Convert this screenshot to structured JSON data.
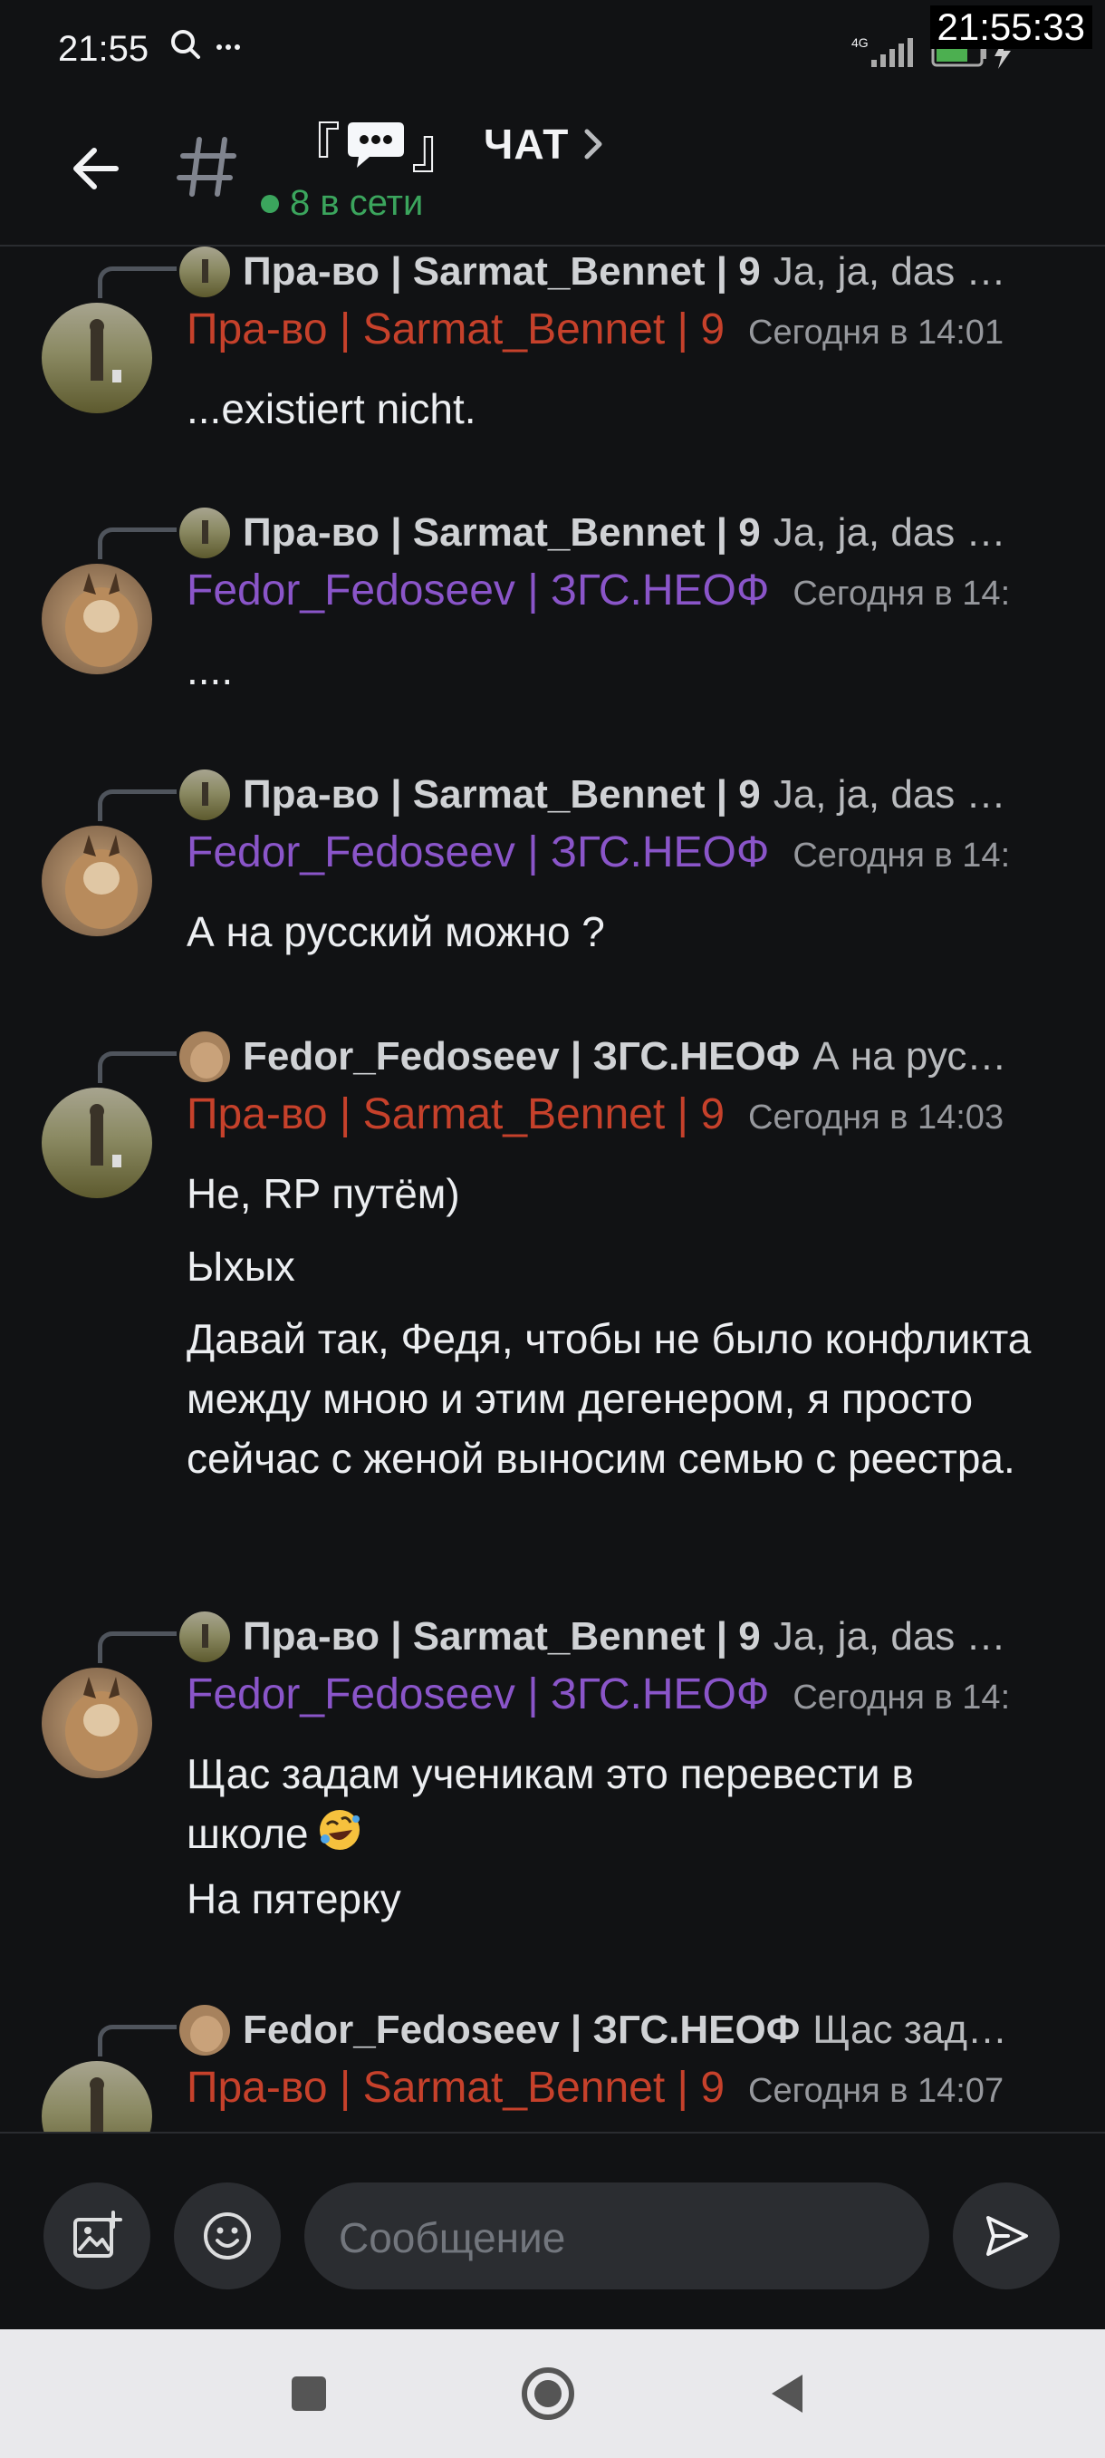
{
  "status_bar": {
    "time": "21:55",
    "clock_overlay": "21:55:33",
    "network": "4G",
    "battery": "69"
  },
  "header": {
    "title_bracket_left": "『",
    "title_bracket_right": "』",
    "title": "ЧАТ",
    "online": "8 в сети"
  },
  "messages": [
    {
      "reply_name": "Пра-во | Sarmat_Bennet | 9",
      "reply_text": "Ja, ja, das …",
      "author": "Пра-во | Sarmat_Bennet | 9",
      "time": "Сегодня в 14:01",
      "lines": [
        "...existiert nicht."
      ]
    },
    {
      "reply_name": "Пра-во | Sarmat_Bennet | 9",
      "reply_text": "Ja, ja, das …",
      "author": "Fedor_Fedoseev | ЗГС.НЕОФ",
      "time": "Сегодня в 14:",
      "lines": [
        "...."
      ]
    },
    {
      "reply_name": "Пра-во | Sarmat_Bennet | 9",
      "reply_text": "Ja, ja, das …",
      "author": "Fedor_Fedoseev | ЗГС.НЕОФ",
      "time": "Сегодня в 14:",
      "lines": [
        "А на русский можно ?"
      ]
    },
    {
      "reply_name": "Fedor_Fedoseev | ЗГС.НЕОФ",
      "reply_text": "А на рус…",
      "author": "Пра-во | Sarmat_Bennet | 9",
      "time": "Сегодня в 14:03",
      "lines": [
        "Не, RP путём)",
        "Ыхых",
        "Давай так, Федя, чтобы не было конфликта между мною и этим дегенером, я просто сейчас с женой выносим семью с реестра."
      ]
    },
    {
      "reply_name": "Пра-во | Sarmat_Bennet | 9",
      "reply_text": "Ja, ja, das …",
      "author": "Fedor_Fedoseev | ЗГС.НЕОФ",
      "time": "Сегодня в 14:",
      "lines": [
        "Щас задам ученикам это перевести в школе",
        "На пятерку"
      ]
    },
    {
      "reply_name": "Fedor_Fedoseev | ЗГС.НЕОФ",
      "reply_text": "Щас зад…",
      "author": "Пра-во | Sarmat_Bennet | 9",
      "time": "Сегодня в 14:07",
      "lines": []
    }
  ],
  "composer": {
    "placeholder": "Сообщение"
  },
  "colors": {
    "red_user": "#c6412b",
    "purple_user": "#8a55c9",
    "online": "#3ba55d"
  },
  "icons": [
    "back-arrow-icon",
    "hash-icon",
    "speech-bubble-icon",
    "chevron-right-icon",
    "image-add-icon",
    "emoji-icon",
    "send-icon",
    "square-nav-icon",
    "home-circle-nav-icon",
    "back-triangle-nav-icon"
  ]
}
